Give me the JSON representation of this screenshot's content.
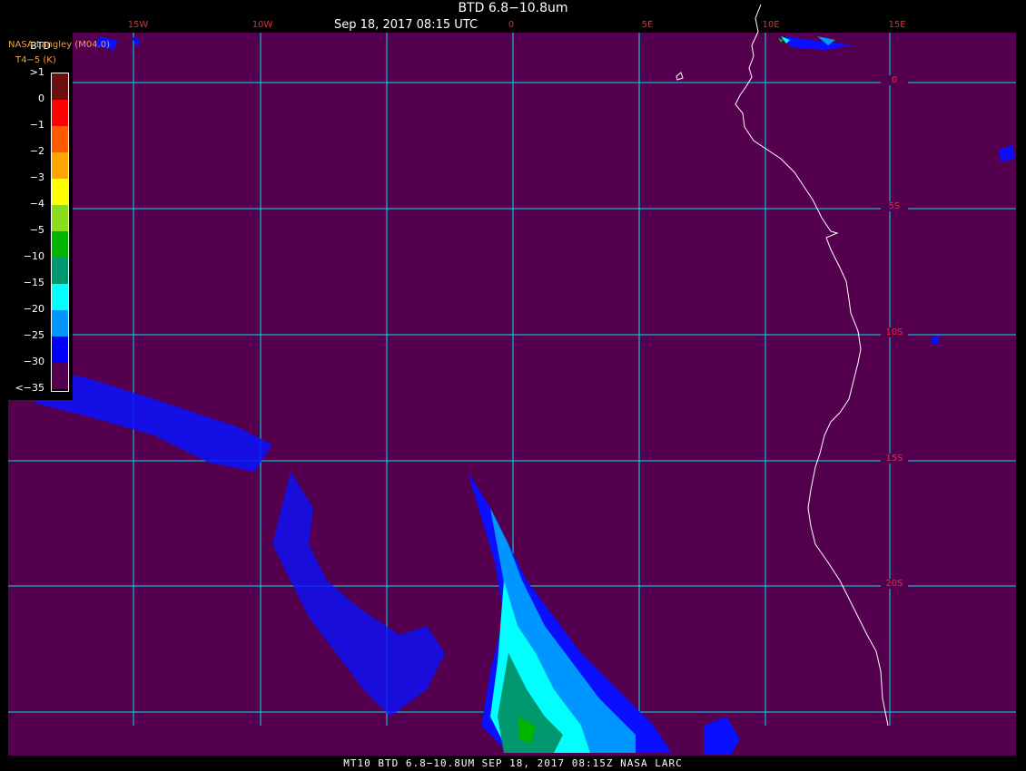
{
  "header": {
    "title": "BTD 6.8−10.8um",
    "datetime": "Sep 18, 2017 08:15 UTC",
    "organization": "NASA Langley (M04.0)"
  },
  "legend": {
    "title": "BTD",
    "subtitle": "T4−5 (K)",
    "labels": [
      ">1",
      "0",
      "−1",
      "−2",
      "−3",
      "−4",
      "−5",
      "−10",
      "−15",
      "−20",
      "−25",
      "−30",
      "<−35"
    ],
    "colors": [
      "#6b1010",
      "#ff0000",
      "#ff5a00",
      "#ffa500",
      "#ffff00",
      "#8cdc1e",
      "#00b400",
      "#00966e",
      "#00ffff",
      "#0096ff",
      "#0000ff",
      "#55004f"
    ]
  },
  "grid": {
    "lon_labels": [
      "15W",
      "10W",
      "0",
      "5E",
      "10E",
      "15E"
    ],
    "lat_labels": [
      "0",
      "5S",
      "10S",
      "15S",
      "20S"
    ],
    "color": "#00e0e0",
    "label_color": "#e03030"
  },
  "colors": {
    "background": "#55004f",
    "coast": "#ffffff"
  },
  "footer": {
    "text": "MT10  BTD 6.8−10.8UM   SEP 18, 2017 08:15Z   NASA LARC"
  }
}
